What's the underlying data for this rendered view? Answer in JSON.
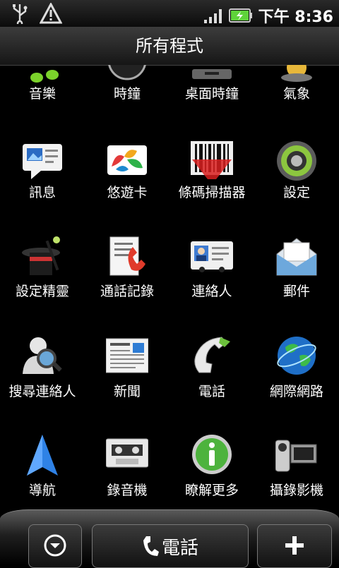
{
  "status": {
    "time_prefix": "下午",
    "time": "8:36"
  },
  "title": "所有程式",
  "apps": [
    {
      "label": "音樂",
      "icon": "music-icon"
    },
    {
      "label": "時鐘",
      "icon": "clock-icon"
    },
    {
      "label": "桌面時鐘",
      "icon": "desk-clock-icon"
    },
    {
      "label": "氣象",
      "icon": "weather-icon"
    },
    {
      "label": "訊息",
      "icon": "messages-icon"
    },
    {
      "label": "悠遊卡",
      "icon": "easycard-icon"
    },
    {
      "label": "條碼掃描器",
      "icon": "barcode-scanner-icon"
    },
    {
      "label": "設定",
      "icon": "settings-gear-icon"
    },
    {
      "label": "設定精靈",
      "icon": "setup-wizard-icon"
    },
    {
      "label": "通話記錄",
      "icon": "call-history-icon"
    },
    {
      "label": "連絡人",
      "icon": "contacts-icon"
    },
    {
      "label": "郵件",
      "icon": "mail-icon"
    },
    {
      "label": "搜尋連絡人",
      "icon": "search-contacts-icon"
    },
    {
      "label": "新聞",
      "icon": "news-icon"
    },
    {
      "label": "電話",
      "icon": "phone-icon"
    },
    {
      "label": "網際網路",
      "icon": "globe-icon"
    },
    {
      "label": "導航",
      "icon": "navigation-icon"
    },
    {
      "label": "錄音機",
      "icon": "voice-recorder-icon"
    },
    {
      "label": "瞭解更多",
      "icon": "info-icon"
    },
    {
      "label": "攝錄影機",
      "icon": "camcorder-icon"
    }
  ],
  "bottom": {
    "phone_label": "電話"
  },
  "colors": {
    "battery": "#5fd33a",
    "accent_green": "#7bd22b"
  }
}
